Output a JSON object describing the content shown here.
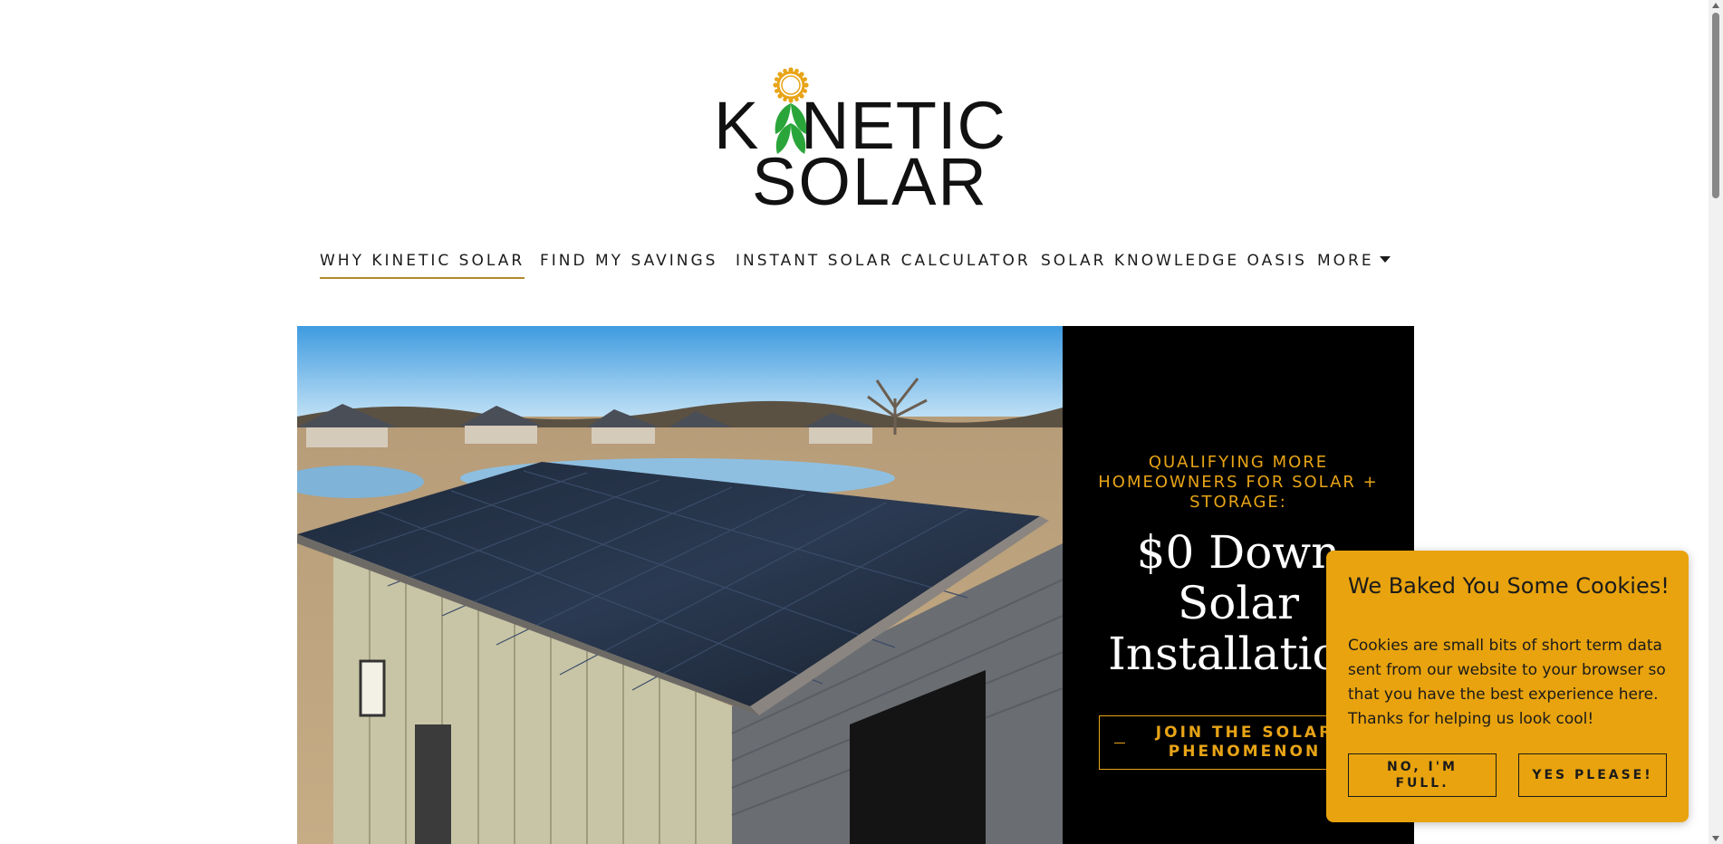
{
  "brand": {
    "logo_line1_k": "K",
    "logo_line1_rest": "NETIC",
    "logo_line2": "SOLAR",
    "icon": "sunflower-leaf-icon",
    "colors": {
      "sun": "#e8a416",
      "leaf": "#2aa53a"
    }
  },
  "nav": {
    "items": [
      {
        "label": "WHY KINETIC SOLAR",
        "active": true
      },
      {
        "label": "FIND MY SAVINGS",
        "active": false
      },
      {
        "label": "INSTANT SOLAR CALCULATOR",
        "active": false
      },
      {
        "label": "SOLAR KNOWLEDGE OASIS",
        "active": false
      },
      {
        "label": "MORE",
        "active": false
      }
    ],
    "active_underline_color": "#b08a2a"
  },
  "hero": {
    "eyebrow": "QUALIFYING MORE HOMEOWNERS FOR SOLAR + STORAGE:",
    "title_line1": "$0 Down",
    "title_line2": "Solar",
    "title_line3": "Installation",
    "cta_label": "JOIN THE SOLAR PHENOMENON",
    "accent_color": "#e8a416",
    "image": "solar-panel-roof-photo"
  },
  "cookie": {
    "title": "We Baked You Some Cookies!",
    "body": "Cookies are small bits of short term data sent from our website to your browser so that you have the best experience here. Thanks for helping us look cool!",
    "decline_label": "NO, I'M FULL.",
    "accept_label": "YES PLEASE!",
    "background_color": "#e8a30e"
  }
}
